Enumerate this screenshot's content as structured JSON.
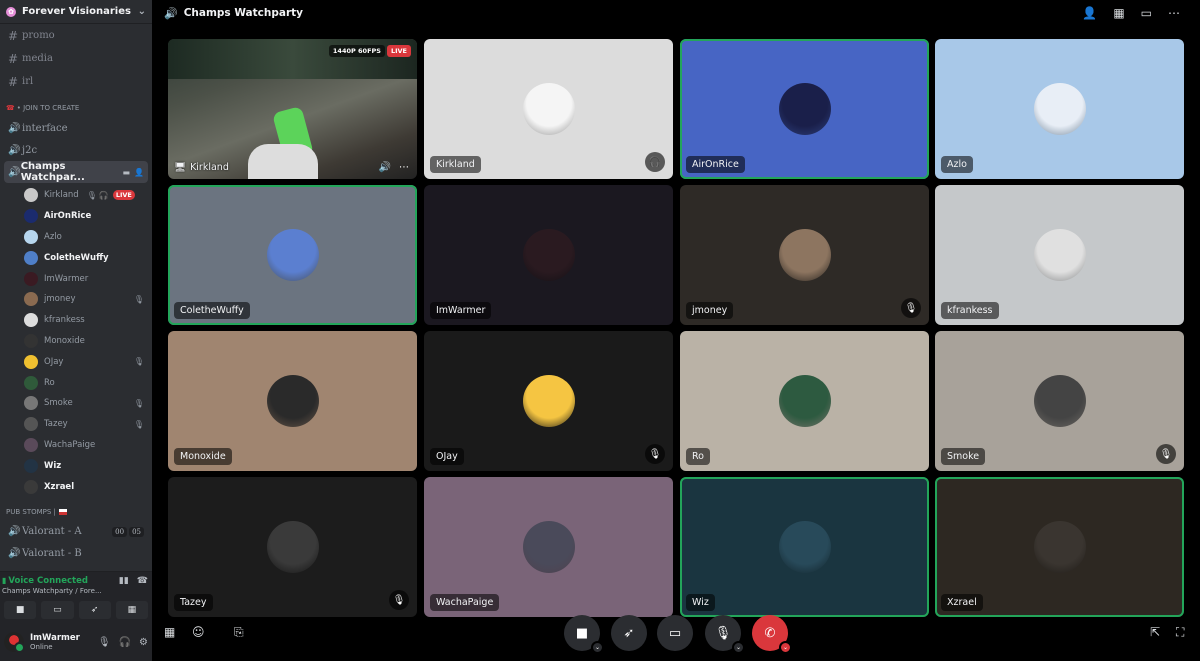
{
  "server": {
    "name": "Forever Visionaries"
  },
  "text_channels": [
    {
      "name": "promo"
    },
    {
      "name": "media"
    },
    {
      "name": "irl"
    }
  ],
  "category_join": "• JOIN TO CREATE",
  "voice_channels_top": [
    {
      "name": "interface"
    },
    {
      "name": "j2c"
    }
  ],
  "active_channel": {
    "name": "Champs Watchpar..."
  },
  "voice_users": [
    {
      "name": "Kirkland",
      "live": "LIVE",
      "color": "#c9c9c9"
    },
    {
      "name": "AirOnRice",
      "bright": true,
      "color": "#1b2b6e"
    },
    {
      "name": "Azlo",
      "color": "#b7d6ee"
    },
    {
      "name": "ColetheWuffy",
      "bright": true,
      "color": "#4f7fc8"
    },
    {
      "name": "ImWarmer",
      "color": "#3a1a22"
    },
    {
      "name": "jmoney",
      "muted": true,
      "color": "#8a6a50"
    },
    {
      "name": "kfrankess",
      "color": "#ddd"
    },
    {
      "name": "Monoxide",
      "color": "#333"
    },
    {
      "name": "OJay",
      "muted": true,
      "color": "#f0c030"
    },
    {
      "name": "Ro",
      "color": "#2f5a3a"
    },
    {
      "name": "Smoke",
      "muted": true,
      "color": "#777"
    },
    {
      "name": "Tazey",
      "muted": true,
      "color": "#555"
    },
    {
      "name": "WachaPaige",
      "color": "#5a4a5a"
    },
    {
      "name": "Wiz",
      "bright": true,
      "color": "#234"
    },
    {
      "name": "Xzrael",
      "bright": true,
      "color": "#3a3a3a"
    }
  ],
  "category_pub": "PUB STOMPS |",
  "bottom_channels": [
    {
      "name": "Valorant - A",
      "c1": "00",
      "c2": "05"
    },
    {
      "name": "Valorant - B",
      "c1": "",
      "c2": ""
    }
  ],
  "voice_panel": {
    "status": "Voice Connected",
    "channel": "Champs Watchparty / Fore..."
  },
  "user_bar": {
    "name": "ImWarmer",
    "status": "Online"
  },
  "topbar": {
    "title": "Champs Watchparty"
  },
  "stream": {
    "quality": "1440P 60FPS",
    "live": "LIVE",
    "name": "Kirkland"
  },
  "tiles": [
    {
      "name": "Kirkland",
      "bg": "#dcdcdc",
      "av": "#f5f5f5",
      "deafened": true
    },
    {
      "name": "AirOnRice",
      "bg": "#4765c4",
      "av": "#1a1f4a",
      "speaking": true
    },
    {
      "name": "Azlo",
      "bg": "#a8c8e8",
      "av": "#e8eef6"
    },
    {
      "name": "ColetheWuffy",
      "bg": "#6b7480",
      "av": "#5b7fd0",
      "speaking": true
    },
    {
      "name": "ImWarmer",
      "bg": "#1b1820",
      "av": "#2a1a20"
    },
    {
      "name": "jmoney",
      "bg": "#2e2a26",
      "av": "#8d7560",
      "muted": true
    },
    {
      "name": "kfrankess",
      "bg": "#c5c8ca",
      "av": "#e0e0e0"
    },
    {
      "name": "Monoxide",
      "bg": "#a08570",
      "av": "#2a2a2a"
    },
    {
      "name": "OJay",
      "bg": "#1a1a1a",
      "av": "#f5c542",
      "muted": true
    },
    {
      "name": "Ro",
      "bg": "#bab2a6",
      "av": "#2d5a40"
    },
    {
      "name": "Smoke",
      "bg": "#a8a29a",
      "av": "#444",
      "muted": true
    },
    {
      "name": "Tazey",
      "bg": "#1c1c1c",
      "av": "#3a3a3a",
      "muted": true
    },
    {
      "name": "WachaPaige",
      "bg": "#7a6478",
      "av": "#4a4a5a"
    },
    {
      "name": "Wiz",
      "bg": "#1a3540",
      "av": "#284a5a",
      "speaking": true
    },
    {
      "name": "Xzrael",
      "bg": "#2d2822",
      "av": "#3a3530",
      "speaking": true
    }
  ]
}
